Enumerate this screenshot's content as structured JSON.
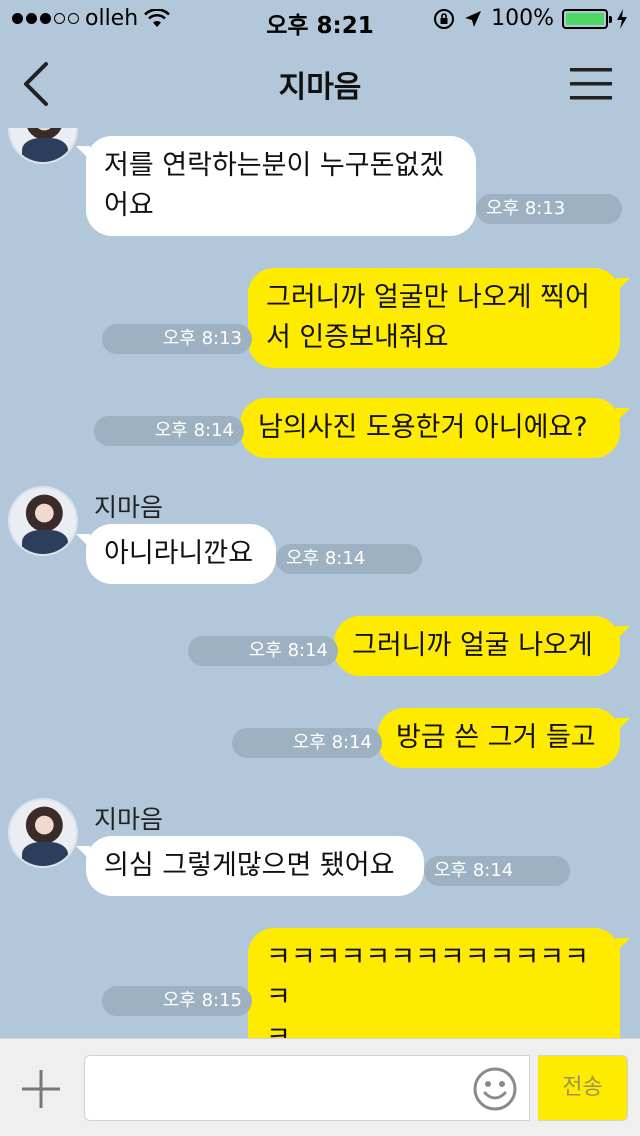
{
  "status": {
    "carrier": "olleh",
    "time": "오후 8:21",
    "battery": "100%",
    "battery_level": 1.0,
    "signal_bars_filled": 3,
    "signal_bars_total": 5
  },
  "header": {
    "title": "지마음"
  },
  "messages": [
    {
      "dir": "in",
      "show_sender": false,
      "text": "저를 연락하는분이 누구돈없겠\n어요",
      "time": "오후 8:13"
    },
    {
      "dir": "out",
      "text": "그러니까 얼굴만 나오게 찍어\n서 인증보내줘요",
      "time": "오후 8:13"
    },
    {
      "dir": "out",
      "text": "남의사진 도용한거 아니에요?",
      "time": "오후 8:14"
    },
    {
      "dir": "in",
      "show_sender": true,
      "sender": "지마음",
      "text": "아니라니깐요",
      "time": "오후 8:14"
    },
    {
      "dir": "out",
      "text": "그러니까 얼굴 나오게",
      "time": "오후 8:14"
    },
    {
      "dir": "out",
      "text": "방금 쓴 그거 들고",
      "time": "오후 8:14"
    },
    {
      "dir": "in",
      "show_sender": true,
      "sender": "지마음",
      "text": "의심 그렇게많으면 됐어요",
      "time": "오후 8:14"
    },
    {
      "dir": "out",
      "text": "ㅋㅋㅋㅋㅋㅋㅋㅋㅋㅋㅋㅋㅋㅋ\nㅋ",
      "time": "오후 8:15"
    }
  ],
  "input": {
    "send_label": "전송"
  },
  "colors": {
    "chat_background": "#b2c7d9",
    "outgoing_bubble": "#ffeb00",
    "incoming_bubble": "#ffffff",
    "battery_fill": "#4cd964"
  },
  "icons": {
    "back": "chevron-left-icon",
    "menu": "hamburger-menu-icon",
    "plus": "plus-icon",
    "emoji": "smiley-icon",
    "wifi": "wifi-icon",
    "location": "location-arrow-icon",
    "rotation_lock": "rotation-lock-icon",
    "charging": "charging-bolt-icon"
  }
}
